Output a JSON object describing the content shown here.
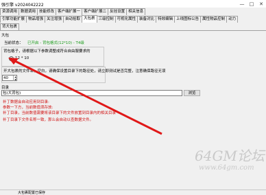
{
  "window": {
    "title": "强引擎 v2024042222",
    "controls": [
      "—",
      "□",
      "✕"
    ]
  },
  "tabs_row1": [
    "资源调用",
    "数据调用",
    "技能修改",
    "客户端扩展一",
    "客户端扩展二",
    "反挂设置",
    "相关信息"
  ],
  "tabs_row2": [
    "引擎功能扩展",
    "物品增强",
    "关注增强",
    "自动拾取",
    "大包裹",
    "三级控制",
    "可视化属性",
    "装备对比",
    "特效编辑",
    "上线图标公告",
    "属性物品控制",
    "动力"
  ],
  "tabs_row3": [
    "背大包裹"
  ],
  "active_tab_row2": "大包裹",
  "panel": {
    "section_title": "大包",
    "status_label": "当前状态：",
    "status_value": "已开启 - 背包格式(12*10) - T4级",
    "mode_label": "背包格子，请根据以下参数调整成符合自由服要求的",
    "mode_option": "12 * 10",
    "warn_text": "开大包裹的文件名，空白，请确保设置目录下的路径处，请立即测试是否完整，注意确保路径无误",
    "number_value": "40",
    "dir_label": "目录",
    "dir_value": "包(大背包)",
    "browse_label": "浏览",
    "notes": [
      "补丁数据会自动应用到目录:",
      "参数一下方，当前数值须存放:",
      "补丁目录，当前数值需要将该目录下的文件放置到目录内的相关目录",
      "补丁目录下文件名称一致，那么会自动以查数据文件。"
    ]
  },
  "statusbar": {
    "text": "大包裹配置已保存"
  },
  "watermark": {
    "logo": "64GM论坛",
    "url": "www.64gm.com"
  }
}
